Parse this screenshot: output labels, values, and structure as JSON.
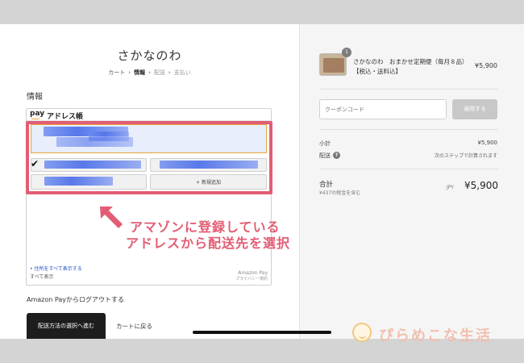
{
  "store": {
    "title": "さかなのわ"
  },
  "breadcrumb": {
    "cart": "カート",
    "info": "情報",
    "shipping": "配送",
    "payment": "支払い"
  },
  "section_title": "情報",
  "amazon_widget": {
    "logo": "pay",
    "heading": "アドレス帳",
    "add_new": "+ 新規追加",
    "show_all_link": "• 住所をすべて表示する",
    "show_all_text": "すべて表示",
    "brand_mark": "Amazon Pay",
    "privacy_link": "プライバシー規約"
  },
  "logout_text": "Amazon Payからログアウトする",
  "primary_button": "配送方法の選択へ進む",
  "back_link": "カートに戻る",
  "annotation": {
    "line1": "アマゾンに登録している",
    "line2": "アドレスから配送先を選択"
  },
  "order": {
    "item_name": "さかなのわ　おまかせ定期便（毎月８品）【税込・送料込】",
    "item_price": "¥5,900",
    "quantity_badge": "1",
    "coupon_placeholder": "クーポンコード",
    "apply_button": "適用する",
    "subtotal_label": "小計",
    "subtotal_value": "¥5,900",
    "shipping_label": "配送",
    "shipping_value": "次のステップで計算されます",
    "total_label": "合計",
    "tax_note": "¥437の税金を含む",
    "currency": "JPY",
    "total_value": "¥5,900"
  },
  "watermark": {
    "text": "ぴらめこな生活"
  },
  "colors": {
    "highlight": "#e25d74",
    "selected_border": "#e6a53d",
    "primary_button": "#1d1d1d",
    "link": "#1a4ec8"
  },
  "icons": [
    "checkmark-icon",
    "help-icon",
    "arrow-up-left-icon"
  ]
}
